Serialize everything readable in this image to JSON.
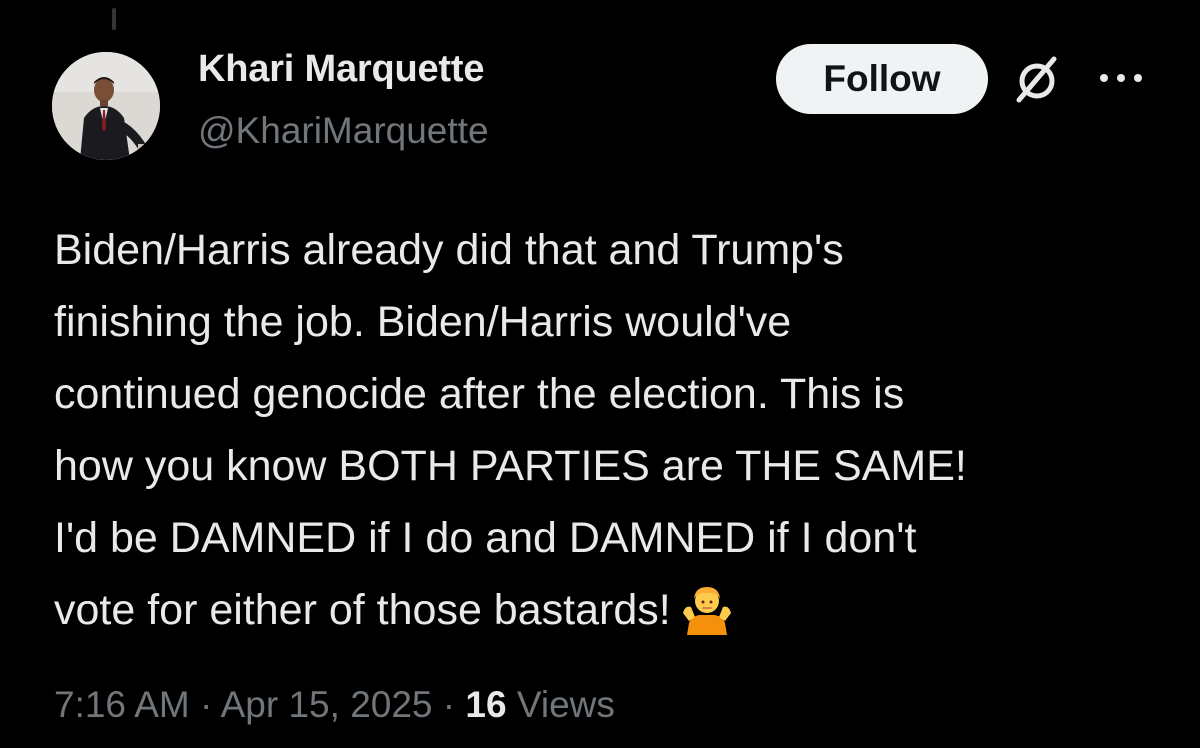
{
  "author": {
    "display_name": "Khari Marquette",
    "handle": "@KhariMarquette"
  },
  "actions": {
    "follow_label": "Follow",
    "grok_icon": "grok-icon",
    "more_icon": "more-horizontal-icon"
  },
  "tweet": {
    "lines": [
      "Biden/Harris already did that and Trump's",
      "finishing the job. Biden/Harris would've",
      "continued genocide after the election. This is",
      "how you know BOTH PARTIES are THE SAME!",
      "I'd be DAMNED if I do and DAMNED if I don't",
      "vote for either of those bastards!"
    ],
    "emoji": "person-shrugging-emoji"
  },
  "meta": {
    "time": "7:16 AM",
    "separator": "·",
    "date": "Apr 15, 2025",
    "views_count": "16",
    "views_label": "Views"
  },
  "colors": {
    "background": "#000000",
    "primary_text": "#e7e9ea",
    "secondary_text": "#71767b",
    "follow_bg": "#eff3f4"
  }
}
